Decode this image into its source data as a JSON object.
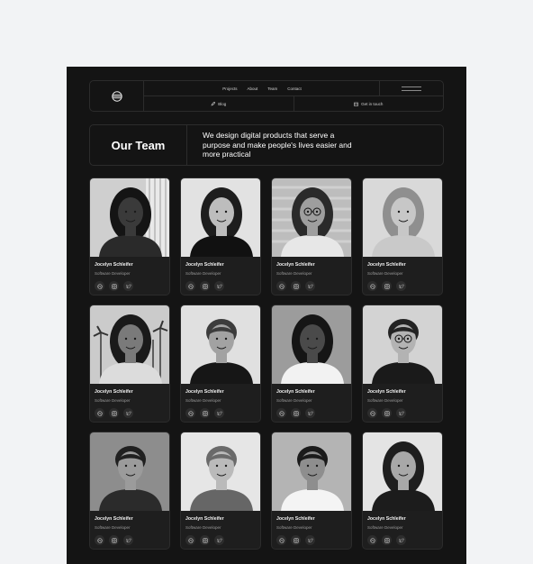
{
  "nav": {
    "links": [
      "Projects",
      "About",
      "Team",
      "Contact"
    ],
    "blog": "Blog",
    "cta": "Get in touch"
  },
  "hero": {
    "title": "Our Team",
    "tagline": "We design digital products that serve a purpose and make people's lives easier and more practical"
  },
  "team": [
    {
      "name": "Jocelyn Schleifer",
      "role": "Software Developer",
      "photo": "woman-long-braids"
    },
    {
      "name": "Jocelyn Schleifer",
      "role": "Software Developer",
      "photo": "woman-curly-hair"
    },
    {
      "name": "Jocelyn Schleifer",
      "role": "Software Developer",
      "photo": "woman-glasses-buns"
    },
    {
      "name": "Jocelyn Schleifer",
      "role": "Software Developer",
      "photo": "woman-blonde"
    },
    {
      "name": "Jocelyn Schleifer",
      "role": "Software Developer",
      "photo": "woman-palm-trees"
    },
    {
      "name": "Jocelyn Schleifer",
      "role": "Software Developer",
      "photo": "man-black-sweater"
    },
    {
      "name": "Jocelyn Schleifer",
      "role": "Software Developer",
      "photo": "woman-braids-smiling"
    },
    {
      "name": "Jocelyn Schleifer",
      "role": "Software Developer",
      "photo": "man-glasses"
    },
    {
      "name": "Jocelyn Schleifer",
      "role": "Software Developer",
      "photo": "man-suit"
    },
    {
      "name": "Jocelyn Schleifer",
      "role": "Software Developer",
      "photo": "man-light-hair"
    },
    {
      "name": "Jocelyn Schleifer",
      "role": "Software Developer",
      "photo": "man-smiling-white-tee"
    },
    {
      "name": "Jocelyn Schleifer",
      "role": "Software Developer",
      "photo": "woman-dark-hair"
    }
  ],
  "social_icons": [
    "dribbble-icon",
    "instagram-icon",
    "twitter-icon"
  ],
  "colors": {
    "page": "#f2f3f5",
    "panel": "#141414",
    "card": "#1e1e1e",
    "border": "#2c2c2c",
    "text": "#ffffff",
    "muted": "#9a9a9a"
  }
}
